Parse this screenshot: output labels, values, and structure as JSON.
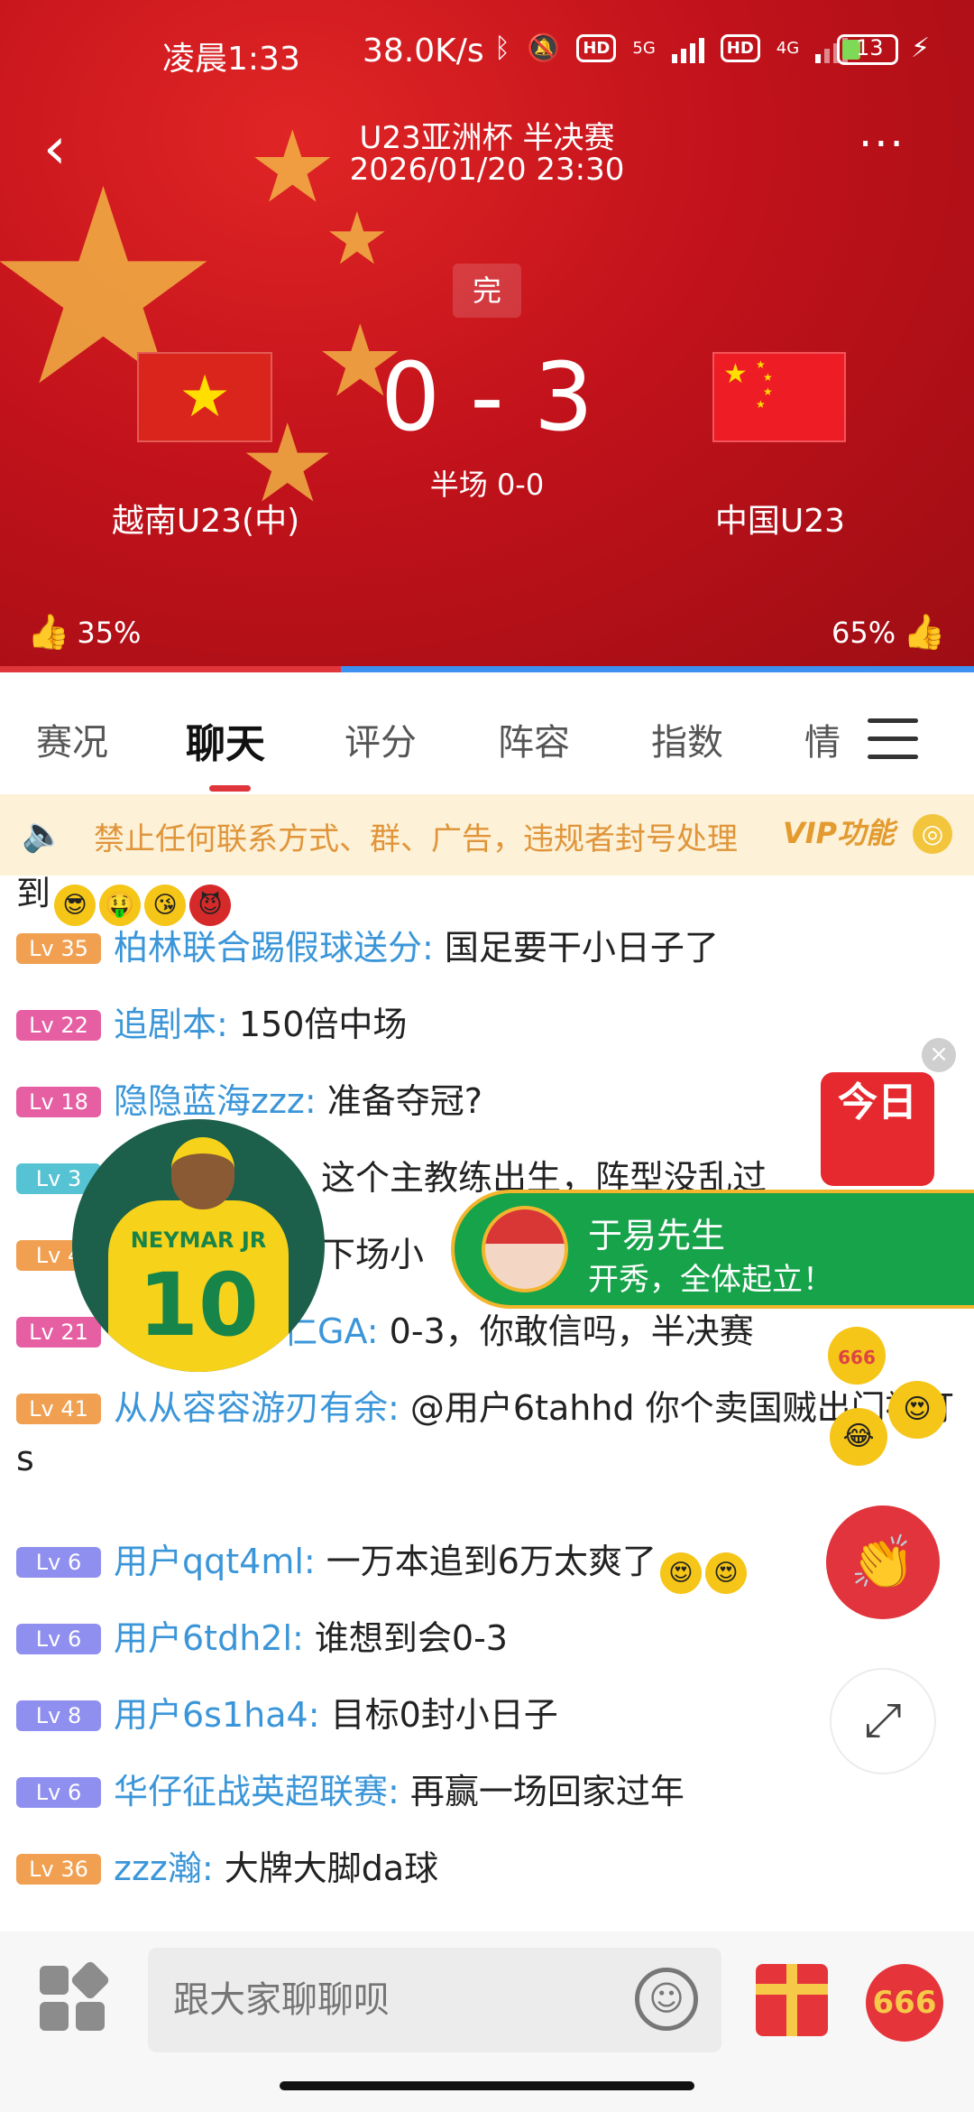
{
  "status_bar": {
    "time": "凌晨1:33",
    "network_speed": "38.0K/s",
    "hd1": "HD",
    "net1": "5G",
    "hd2": "HD",
    "net2": "4G",
    "battery": "13"
  },
  "match": {
    "title": "U23亚洲杯 半决赛",
    "datetime": "2026/01/20 23:30",
    "status": "完",
    "score": "0 - 3",
    "halftime": "半场 0-0",
    "home_team": "越南U23(中)",
    "away_team": "中国U23",
    "home_vote": "35%",
    "away_vote": "65%",
    "home_vote_fraction": 0.35
  },
  "tabs": [
    {
      "label": "赛况"
    },
    {
      "label": "聊天"
    },
    {
      "label": "评分"
    },
    {
      "label": "阵容"
    },
    {
      "label": "指数"
    },
    {
      "label": "情"
    }
  ],
  "notice": {
    "text": "禁止任何联系方式、群、广告，违规者封号处理",
    "vip": "VIP功能"
  },
  "chat": {
    "partial_top": "到",
    "messages": [
      {
        "level": "Lv 35",
        "user": "柏林联合踢假球送分:",
        "text": "国足要干小日子了",
        "color": "#f0a050"
      },
      {
        "level": "Lv 22",
        "user": "追剧本:",
        "text": "150倍中场",
        "color": "#e65fa3"
      },
      {
        "level": "Lv 18",
        "user": "隐隐蓝海zzz:",
        "text": "准备夺冠?",
        "color": "#e65fa3"
      },
      {
        "level": "Lv 3",
        "user": "",
        "text": "这个主教练出生，阵型没乱过",
        "color": "#56c3d4"
      },
      {
        "level": "Lv 4",
        "user": "",
        "text": "下场小",
        "color": "#f0a050"
      },
      {
        "level": "Lv 21",
        "user": "",
        "text": "0-3，你敢信吗，半决赛",
        "color": "#e65fa3"
      },
      {
        "level": "Lv 41",
        "user": "从从容容游刃有余:",
        "text": "@用户6tahhd 你个卖国贼出门被打s",
        "color": "#f0a050"
      },
      {
        "level": "Lv 6",
        "user": "用户qqt4ml:",
        "text": "一万本追到6万太爽了",
        "color": "#8f8ff0"
      },
      {
        "level": "Lv 6",
        "user": "用户6tdh2l:",
        "text": "谁想到会0-3",
        "color": "#8f8ff0"
      },
      {
        "level": "Lv 8",
        "user": "用户6s1ha4:",
        "text": "目标0封小日子",
        "color": "#8f8ff0"
      },
      {
        "level": "Lv 6",
        "user": "华仔征战英超联赛:",
        "text": "再赢一场回家过年",
        "color": "#8f8ff0"
      },
      {
        "level": "Lv 36",
        "user": "zzz瀚:",
        "text": "大牌大脚da球",
        "color": "#f0a050"
      }
    ],
    "rainbow_user": "拜仁GA:"
  },
  "entry": {
    "name": "于易先生",
    "message": "开秀，全体起立！"
  },
  "avatar": {
    "jersey_name": "NEYMAR JR",
    "jersey_number": "10"
  },
  "ad": {
    "label": "今日"
  },
  "floating": {
    "six66": "666"
  },
  "input": {
    "placeholder": "跟大家聊聊呗"
  },
  "bottom": {
    "six66": "666"
  }
}
